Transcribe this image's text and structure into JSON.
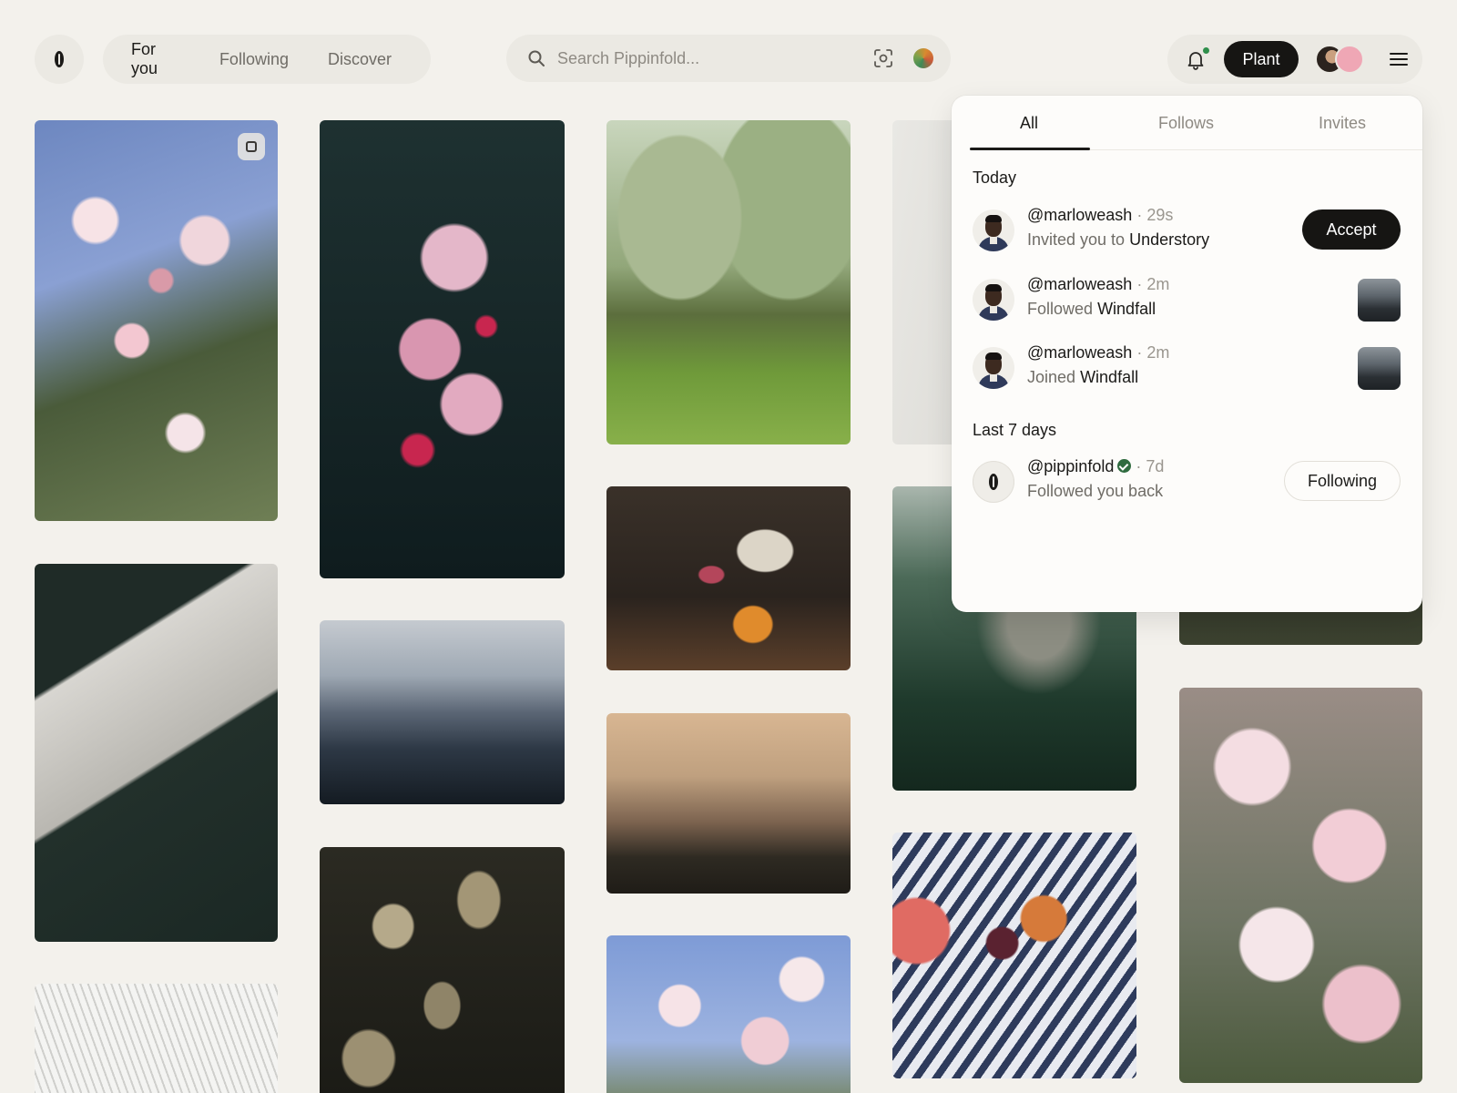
{
  "header": {
    "feed_tabs": [
      {
        "label": "For you",
        "active": true
      },
      {
        "label": "Following",
        "active": false
      },
      {
        "label": "Discover",
        "active": false
      }
    ],
    "search": {
      "placeholder": "Search Pippinfold...",
      "value": ""
    },
    "plant_label": "Plant",
    "has_unread_notifications": true
  },
  "notifications": {
    "tabs": [
      {
        "label": "All",
        "active": true
      },
      {
        "label": "Follows",
        "active": false
      },
      {
        "label": "Invites",
        "active": false
      }
    ],
    "today_label": "Today",
    "last7_label": "Last 7 days",
    "today": [
      {
        "handle": "@marloweash",
        "time": "· 29s",
        "action": "Invited you to",
        "target": "Understory",
        "button": "Accept"
      },
      {
        "handle": "@marloweash",
        "time": "· 2m",
        "action": "Followed",
        "target": "Windfall"
      },
      {
        "handle": "@marloweash",
        "time": "· 2m",
        "action": "Joined",
        "target": "Windfall"
      }
    ],
    "last7": [
      {
        "handle": "@pippinfold",
        "verified": true,
        "time": "· 7d",
        "action": "Followed you back",
        "button": "Following"
      }
    ]
  },
  "colors": {
    "background": "#f3f1ec",
    "pill": "#ebe9e3",
    "primary_button": "#161513",
    "accent_green": "#2f8f4b"
  }
}
